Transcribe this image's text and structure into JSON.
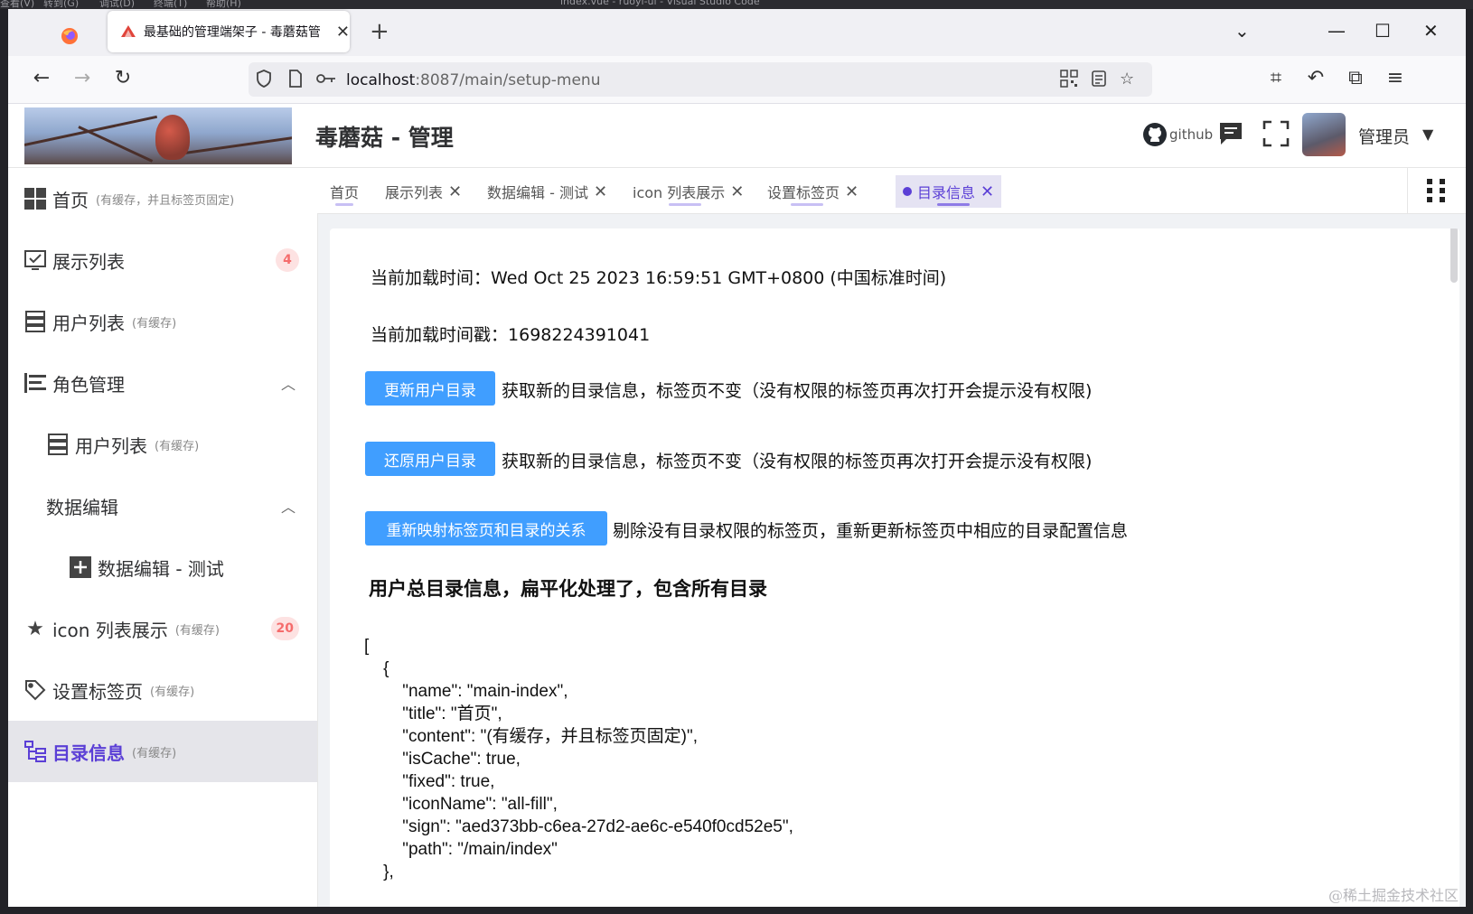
{
  "vscode_menu": [
    "查看(V)",
    "转到(G)",
    "调试(D)",
    "终端(T)",
    "帮助(H)"
  ],
  "vscode_title": "index.vue - ruoyi-ui - Visual Studio Code",
  "browser": {
    "tab_title": "最基础的管理端架子 - 毒蘑菇管",
    "url_host": "localhost",
    "url_rest": ":8087/main/setup-menu"
  },
  "header": {
    "title": "毒蘑菇 - 管理",
    "github": "github",
    "user": "管理员"
  },
  "sidebar": {
    "items": [
      {
        "label": "首页",
        "sub": "(有缓存，并且标签页固定)",
        "icon": "grid-icon"
      },
      {
        "label": "展示列表",
        "badge": "4",
        "icon": "checklist-icon"
      },
      {
        "label": "用户列表",
        "sub": "(有缓存)",
        "icon": "server-icon"
      },
      {
        "label": "角色管理",
        "icon": "list-icon"
      },
      {
        "label": "用户列表",
        "sub": "(有缓存)",
        "icon": "server-icon"
      },
      {
        "label": "数据编辑"
      },
      {
        "label": "数据编辑 - 测试",
        "icon": "plus-box-icon"
      },
      {
        "label": "icon 列表展示",
        "sub": "(有缓存)",
        "badge": "20",
        "icon": "star-icon"
      },
      {
        "label": "设置标签页",
        "sub": "(有缓存)",
        "icon": "tag-icon"
      },
      {
        "label": "目录信息",
        "sub": "(有缓存)",
        "icon": "tree-icon"
      }
    ]
  },
  "tags": [
    {
      "label": "首页"
    },
    {
      "label": "展示列表"
    },
    {
      "label": "数据编辑 - 测试"
    },
    {
      "label": "icon 列表展示"
    },
    {
      "label": "设置标签页"
    },
    {
      "label": "目录信息"
    }
  ],
  "content": {
    "load_time_label": "当前加载时间：",
    "load_time": "Wed Oct 25 2023 16:59:51 GMT+0800 (中国标准时间)",
    "timestamp_label": "当前加载时间戳：",
    "timestamp": "1698224391041",
    "btn_update": "更新用户目录",
    "desc_update": "获取新的目录信息，标签页不变（没有权限的标签页再次打开会提示没有权限)",
    "btn_restore": "还原用户目录",
    "desc_restore": "获取新的目录信息，标签页不变（没有权限的标签页再次打开会提示没有权限)",
    "btn_remap": "重新映射标签页和目录的关系",
    "desc_remap": "剔除没有目录权限的标签页，重新更新标签页中相应的目录配置信息",
    "section_title": "用户总目录信息，扁平化处理了，包含所有目录",
    "json_text": "[\n    {\n        \"name\": \"main-index\",\n        \"title\": \"首页\",\n        \"content\": \"(有缓存，并且标签页固定)\",\n        \"isCache\": true,\n        \"fixed\": true,\n        \"iconName\": \"all-fill\",\n        \"sign\": \"aed373bb-c6ea-27d2-ae6c-e540f0cd52e5\",\n        \"path\": \"/main/index\"\n    },"
  },
  "watermark": "@稀土掘金技术社区",
  "colors": {
    "accent": "#5b3fd6",
    "button": "#409eff",
    "badge_bg": "#fde2e2",
    "badge_text": "#f56c6c"
  }
}
